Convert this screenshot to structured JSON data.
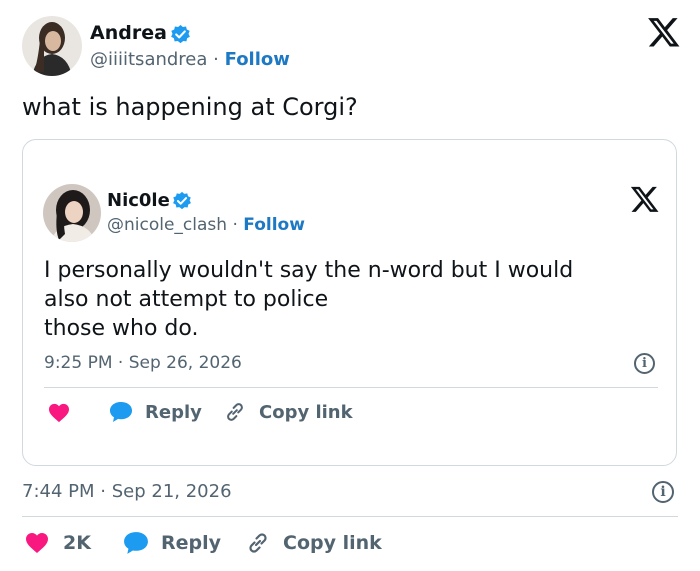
{
  "tweet": {
    "author_name": "Andrea",
    "author_handle": "@iiiitsandrea",
    "separator": "·",
    "follow_label": "Follow",
    "text": "what is happening at Corgi?",
    "time": "7:44 PM",
    "date": "Sep 21, 2026",
    "date_separator": "·",
    "like_count": "2K",
    "reply_label": "Reply",
    "copy_link_label": "Copy link",
    "x_logo": "X"
  },
  "quoted": {
    "author_name": "Nic0le",
    "author_handle": "@nicole_clash",
    "separator": "·",
    "follow_label": "Follow",
    "text_line1": "I personally wouldn't say the n-word but I would",
    "text_line2": "also not attempt to police",
    "text_line3": "those who do.",
    "time": "9:25 PM",
    "date": "Sep 26, 2026",
    "date_separator": "·",
    "reply_label": "Reply",
    "copy_link_label": "Copy link",
    "x_logo": "X"
  },
  "colors": {
    "verified": "#1d9bf0",
    "heart": "#f91880",
    "reply_bubble": "#1d9bf0",
    "follow": "#1d79c4",
    "muted": "#536471",
    "border": "#cfd9de"
  },
  "icons": [
    "verified-badge-icon",
    "x-logo-icon",
    "heart-icon",
    "reply-bubble-icon",
    "link-icon",
    "info-icon"
  ]
}
